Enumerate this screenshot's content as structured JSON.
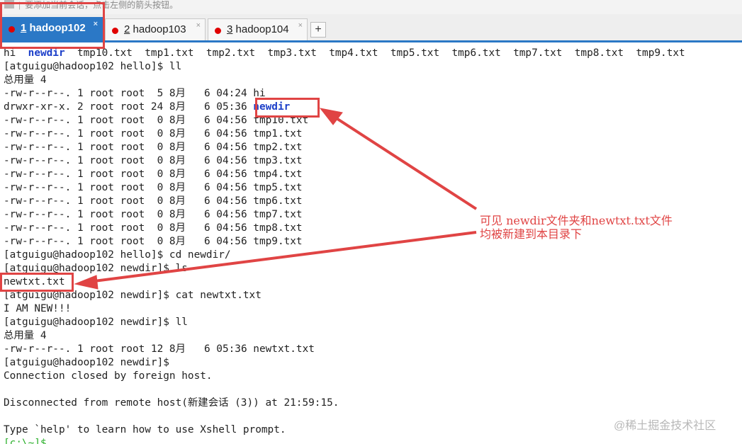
{
  "hint_bar": {
    "text": "要添加当前会话，点击左侧的箭头按钮。"
  },
  "tabs": [
    {
      "number": "1",
      "label": "hadoop102",
      "active": true
    },
    {
      "number": "2",
      "label": "hadoop103",
      "active": false
    },
    {
      "number": "3",
      "label": "hadoop104",
      "active": false
    }
  ],
  "add_tab_label": "+",
  "close_label": "×",
  "terminal": {
    "ls_output": {
      "pre": "hi  ",
      "dir": "newdir",
      "post": "  tmp10.txt  tmp1.txt  tmp2.txt  tmp3.txt  tmp4.txt  tmp5.txt  tmp6.txt  tmp7.txt  tmp8.txt  tmp9.txt"
    },
    "cmd_ll": "[atguigu@hadoop102 hello]$ ll",
    "total1": "总用量 4",
    "file_hi": "-rw-r--r--. 1 root root  5 8月   6 04:24 hi",
    "dir_line_pre": "drwxr-xr-x. 2 root root 24 8月   6 05:36 ",
    "dir_line_name": "newdir",
    "files": [
      "-rw-r--r--. 1 root root  0 8月   6 04:56 tmp10.txt",
      "-rw-r--r--. 1 root root  0 8月   6 04:56 tmp1.txt",
      "-rw-r--r--. 1 root root  0 8月   6 04:56 tmp2.txt",
      "-rw-r--r--. 1 root root  0 8月   6 04:56 tmp3.txt",
      "-rw-r--r--. 1 root root  0 8月   6 04:56 tmp4.txt",
      "-rw-r--r--. 1 root root  0 8月   6 04:56 tmp5.txt",
      "-rw-r--r--. 1 root root  0 8月   6 04:56 tmp6.txt",
      "-rw-r--r--. 1 root root  0 8月   6 04:56 tmp7.txt",
      "-rw-r--r--. 1 root root  0 8月   6 04:56 tmp8.txt",
      "-rw-r--r--. 1 root root  0 8月   6 04:56 tmp9.txt"
    ],
    "cmd_cd": "[atguigu@hadoop102 hello]$ cd newdir/",
    "cmd_ls": "[atguigu@hadoop102 newdir]$ ls",
    "ls_result": "newtxt.txt",
    "cmd_cat": "[atguigu@hadoop102 newdir]$ cat newtxt.txt",
    "cat_output": "I AM NEW!!!",
    "cmd_ll2": "[atguigu@hadoop102 newdir]$ ll",
    "total2": "总用量 4",
    "file_newtxt": "-rw-r--r--. 1 root root 12 8月   6 05:36 newtxt.txt",
    "prompt_end": "[atguigu@hadoop102 newdir]$",
    "conn_closed": "Connection closed by foreign host.",
    "disconnected": "Disconnected from remote host(新建会话 (3)) at 21:59:15.",
    "help": "Type `help' to learn how to use Xshell prompt.",
    "local_prompt": "[c:\\~]$"
  },
  "annotation": {
    "line1": "可见 newdir文件夹和newtxt.txt文件",
    "line2": "均被新建到本目录下",
    "color": "#e04444"
  },
  "watermark": "@稀土掘金技术社区",
  "colors": {
    "tab_active": "#2b78c6",
    "dir": "#1c3fc9",
    "annotation": "#e04444",
    "prompt_green": "#2cb02c"
  }
}
